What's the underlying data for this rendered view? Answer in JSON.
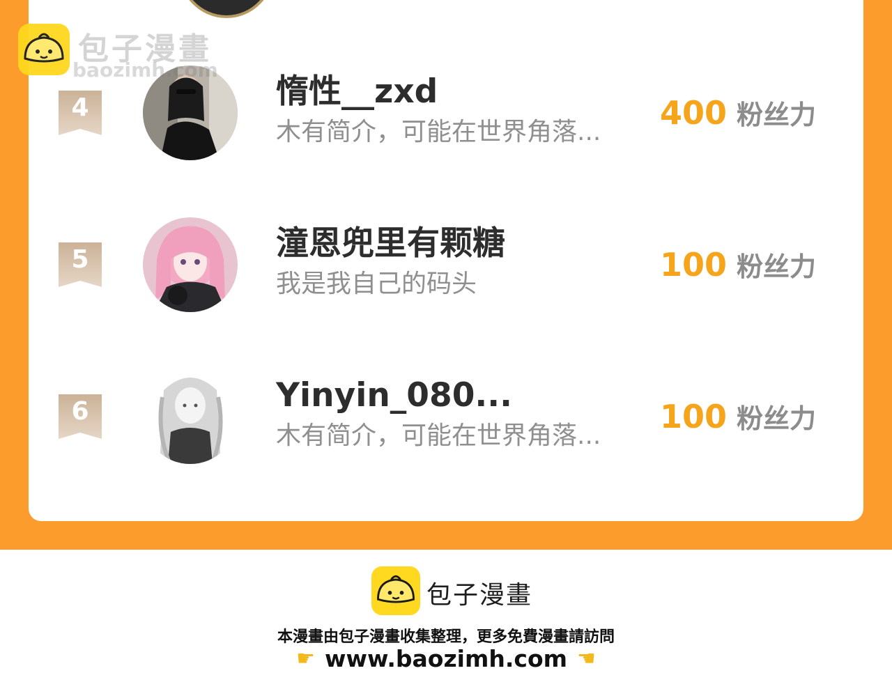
{
  "watermark": {
    "brand": "包子漫畫",
    "url": "baozimh.com"
  },
  "ranking": {
    "rows": [
      {
        "rank": "4",
        "name": "惰性__zxd",
        "bio": "木有简介，可能在世界角落...",
        "fans_value": "400",
        "fans_unit": "粉丝力"
      },
      {
        "rank": "5",
        "name": "潼恩兜里有颗糖",
        "bio": "我是我自己的码头",
        "fans_value": "100",
        "fans_unit": "粉丝力"
      },
      {
        "rank": "6",
        "name": "Yinyin_080...",
        "bio": "木有简介，可能在世界角落...",
        "fans_value": "100",
        "fans_unit": "粉丝力"
      }
    ]
  },
  "footer": {
    "brand": "包子漫畫",
    "note": "本漫畫由包子漫畫收集整理，更多免費漫畫請訪問",
    "url": "www.baozimh.com",
    "icons": [
      "bun-logo-icon",
      "pointing-right-hand-icon",
      "pointing-left-hand-icon"
    ]
  },
  "colors": {
    "orange": "#fb9c2c",
    "gold": "#f5a51c",
    "logo_yellow": "#ffd81f"
  }
}
